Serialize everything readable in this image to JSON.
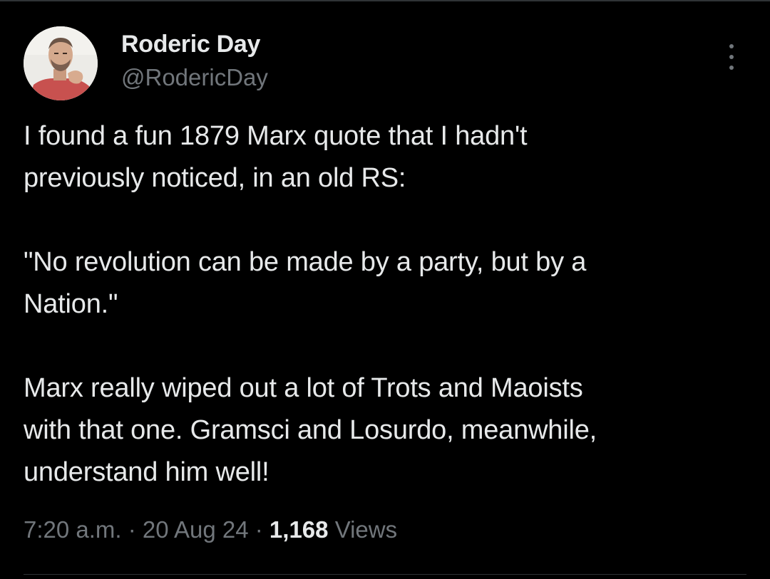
{
  "tweet": {
    "author": {
      "display_name": "Roderic Day",
      "handle": "@RodericDay",
      "avatar": "avatar-photo"
    },
    "more_icon": "more-vertical-icon",
    "paragraphs": [
      [
        "I found a fun 1879 Marx quote that I hadn't",
        "previously noticed, in an old RS:"
      ],
      [
        "\"No revolution can be made by a party, but by a",
        "Nation.\""
      ],
      [
        "Marx really wiped out a lot of Trots and Maoists",
        "with that one. Gramsci and Losurdo, meanwhile,",
        "understand him well!"
      ]
    ],
    "meta": {
      "time": "7:20 a.m.",
      "separator": "·",
      "date": "20 Aug 24",
      "views_count": "1,168",
      "views_label": "Views"
    }
  },
  "colors": {
    "background": "#000000",
    "primary_text": "#e7e9ea",
    "secondary_text": "#71767b",
    "divider": "#2f3336"
  }
}
